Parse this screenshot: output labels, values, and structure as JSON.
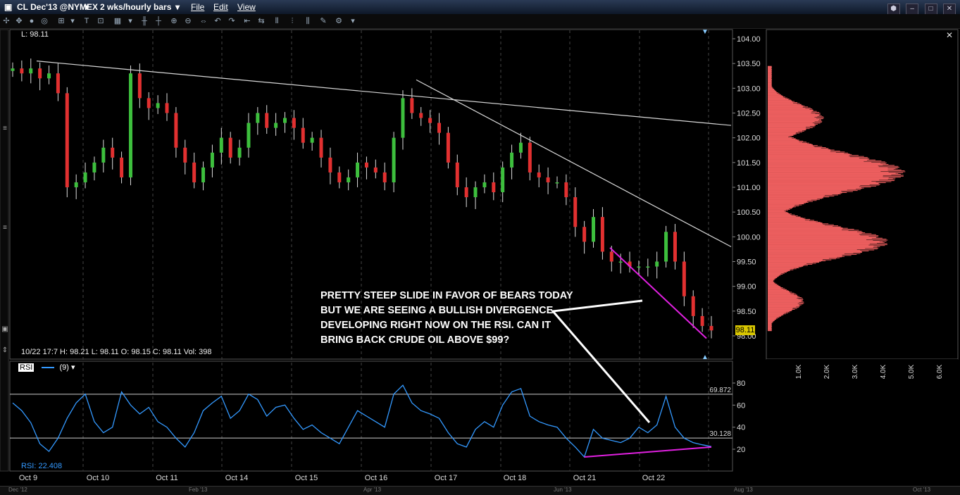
{
  "header": {
    "symbol": "CL Dec'13 @NYMEX",
    "period": "2 wks/hourly bars",
    "menus": [
      "File",
      "Edit",
      "View"
    ]
  },
  "price_panel": {
    "last_label": "L: 98.11",
    "readout": "10/22 17:7    H: 98.21    L: 98.11    O: 98.15    C: 98.11    Vol: 398",
    "price_tag": "98.11"
  },
  "annotation": {
    "text": "PRETTY STEEP SLIDE IN FAVOR OF BEARS TODAY\nBUT WE ARE SEEING A BULLISH DIVERGENCE\nDEVELOPING RIGHT NOW ON THE RSI. CAN IT\nBRING BACK CRUDE OIL ABOVE $99?"
  },
  "rsi_panel": {
    "label": "RSI",
    "param": "(9)",
    "value_label": "RSI: 22.408",
    "upper_band": "69.872",
    "lower_band": "30.128"
  },
  "time_scroller": {
    "labels": [
      "Dec '12",
      "Feb '13",
      "Apr '13",
      "Jun '13",
      "Aug '13",
      "Oct '13"
    ]
  },
  "colors": {
    "up": "#3dbf3d",
    "down": "#e23030",
    "rsi": "#3399ff",
    "divergence": "#e020e0",
    "trendline": "#d8d8d8",
    "volume_profile": "#f06060"
  },
  "chart_data": [
    {
      "type": "candlestick",
      "title": "CL Dec'13 @NYMEX",
      "x_ticks": [
        "Oct 9",
        "Oct 10",
        "Oct 11",
        "Oct 14",
        "Oct 15",
        "Oct 16",
        "Oct 17",
        "Oct 18",
        "Oct 21",
        "Oct 22"
      ],
      "y_ticks": [
        "104.00",
        "103.50",
        "103.00",
        "102.50",
        "102.00",
        "101.50",
        "101.00",
        "100.50",
        "100.00",
        "99.50",
        "99.00",
        "98.50",
        "98.00"
      ],
      "ylim": [
        97.95,
        104.25
      ],
      "close_series": [
        103.4,
        103.3,
        103.4,
        103.2,
        103.3,
        102.9,
        101.0,
        101.1,
        101.3,
        101.5,
        101.8,
        101.6,
        101.2,
        103.3,
        102.8,
        102.6,
        102.7,
        102.5,
        101.8,
        101.5,
        101.1,
        101.4,
        101.7,
        102.0,
        101.6,
        101.8,
        102.3,
        102.5,
        102.2,
        102.3,
        102.4,
        102.2,
        101.9,
        102.0,
        101.6,
        101.3,
        101.1,
        101.2,
        101.5,
        101.4,
        101.3,
        101.1,
        102.0,
        102.8,
        102.5,
        102.4,
        102.3,
        102.1,
        101.5,
        101.0,
        100.8,
        101.0,
        101.1,
        100.9,
        101.4,
        101.7,
        101.9,
        101.3,
        101.2,
        101.1,
        101.1,
        100.8,
        100.2,
        99.9,
        100.4,
        99.7,
        99.5,
        99.5,
        99.4,
        99.4,
        99.4,
        99.5,
        100.1,
        99.5,
        98.8,
        98.4,
        98.2,
        98.11
      ],
      "trendlines_drawn": 2,
      "note": "Candles shown are approximately hourly bars"
    },
    {
      "type": "line",
      "title": "RSI",
      "y_ticks": [
        "80",
        "60",
        "40",
        "20"
      ],
      "ylim": [
        5,
        90
      ],
      "bands": [
        69.872,
        30.128
      ],
      "values": [
        62,
        55,
        44,
        25,
        18,
        30,
        48,
        62,
        70,
        45,
        35,
        40,
        72,
        60,
        52,
        58,
        45,
        40,
        30,
        22,
        35,
        55,
        62,
        68,
        48,
        55,
        70,
        65,
        50,
        58,
        60,
        48,
        38,
        42,
        35,
        30,
        25,
        40,
        55,
        50,
        45,
        40,
        70,
        78,
        62,
        55,
        52,
        48,
        35,
        25,
        22,
        38,
        45,
        40,
        60,
        72,
        75,
        50,
        45,
        42,
        40,
        30,
        22,
        13,
        38,
        30,
        28,
        26,
        30,
        40,
        35,
        42,
        68,
        40,
        30,
        26,
        24,
        22.408
      ],
      "divergence_line": [
        [
          63,
          13
        ],
        [
          77,
          22
        ]
      ]
    },
    {
      "type": "bar",
      "title": "Volume profile",
      "x_ticks": [
        "1.0K",
        "2.0K",
        "3.0K",
        "4.0K",
        "5.0K",
        "6.0K"
      ],
      "xlim": [
        0,
        6.5
      ],
      "note": "Horizontal volume-at-price histogram, peaks near 101.3 and 99.9"
    }
  ]
}
